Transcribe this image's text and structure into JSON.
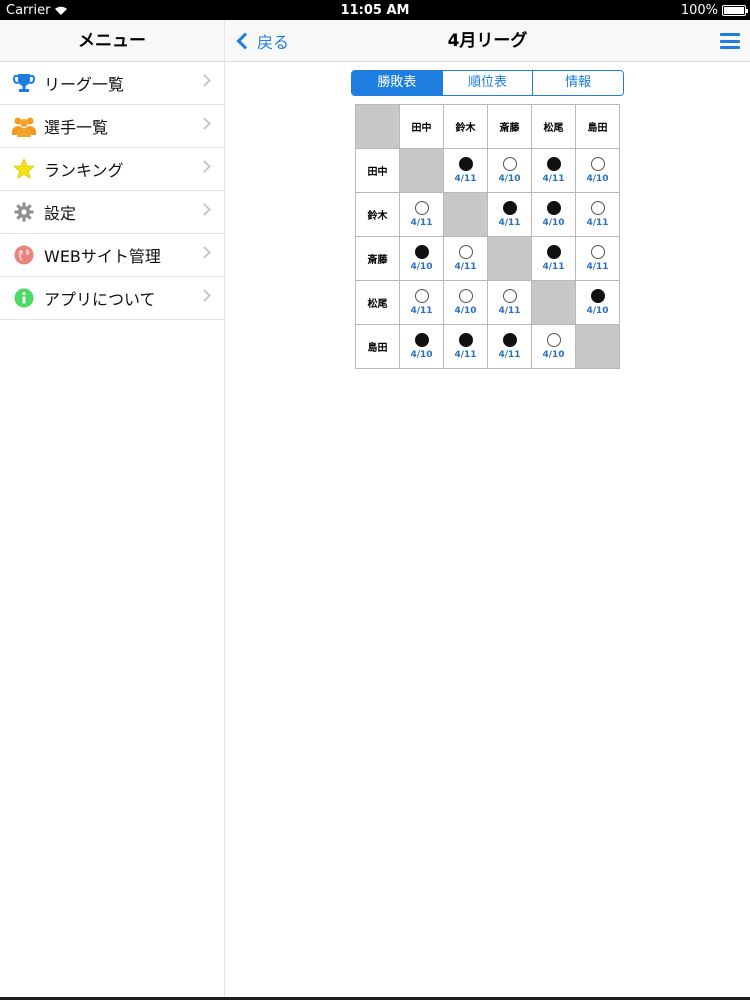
{
  "status": {
    "carrier": "Carrier",
    "time": "11:05 AM",
    "battery": "100%"
  },
  "sidebar": {
    "title": "メニュー",
    "items": [
      {
        "label": "リーグ一覧",
        "icon": "trophy-icon"
      },
      {
        "label": "選手一覧",
        "icon": "players-icon"
      },
      {
        "label": "ランキング",
        "icon": "star-icon"
      },
      {
        "label": "設定",
        "icon": "gear-icon"
      },
      {
        "label": "WEBサイト管理",
        "icon": "globe-icon"
      },
      {
        "label": "アプリについて",
        "icon": "info-icon"
      }
    ]
  },
  "navbar": {
    "back_label": "戻る",
    "title": "4月リーグ"
  },
  "segments": {
    "items": [
      "勝敗表",
      "順位表",
      "情報"
    ],
    "selected": "勝敗表"
  },
  "table": {
    "players": [
      "田中",
      "鈴木",
      "斎藤",
      "松尾",
      "島田"
    ],
    "rows": [
      [
        null,
        {
          "result": "win",
          "date": "4/11"
        },
        {
          "result": "loss",
          "date": "4/10"
        },
        {
          "result": "win",
          "date": "4/11"
        },
        {
          "result": "loss",
          "date": "4/10"
        }
      ],
      [
        {
          "result": "loss",
          "date": "4/11"
        },
        null,
        {
          "result": "win",
          "date": "4/11"
        },
        {
          "result": "win",
          "date": "4/10"
        },
        {
          "result": "loss",
          "date": "4/11"
        }
      ],
      [
        {
          "result": "win",
          "date": "4/10"
        },
        {
          "result": "loss",
          "date": "4/11"
        },
        null,
        {
          "result": "win",
          "date": "4/11"
        },
        {
          "result": "loss",
          "date": "4/11"
        }
      ],
      [
        {
          "result": "loss",
          "date": "4/11"
        },
        {
          "result": "loss",
          "date": "4/10"
        },
        {
          "result": "loss",
          "date": "4/11"
        },
        null,
        {
          "result": "win",
          "date": "4/10"
        }
      ],
      [
        {
          "result": "win",
          "date": "4/10"
        },
        {
          "result": "win",
          "date": "4/11"
        },
        {
          "result": "win",
          "date": "4/11"
        },
        {
          "result": "loss",
          "date": "4/10"
        },
        null
      ]
    ]
  },
  "colors": {
    "accent": "#1e7ee0",
    "date_text": "#2a6fc0",
    "self_cell": "#c8c8c8"
  }
}
